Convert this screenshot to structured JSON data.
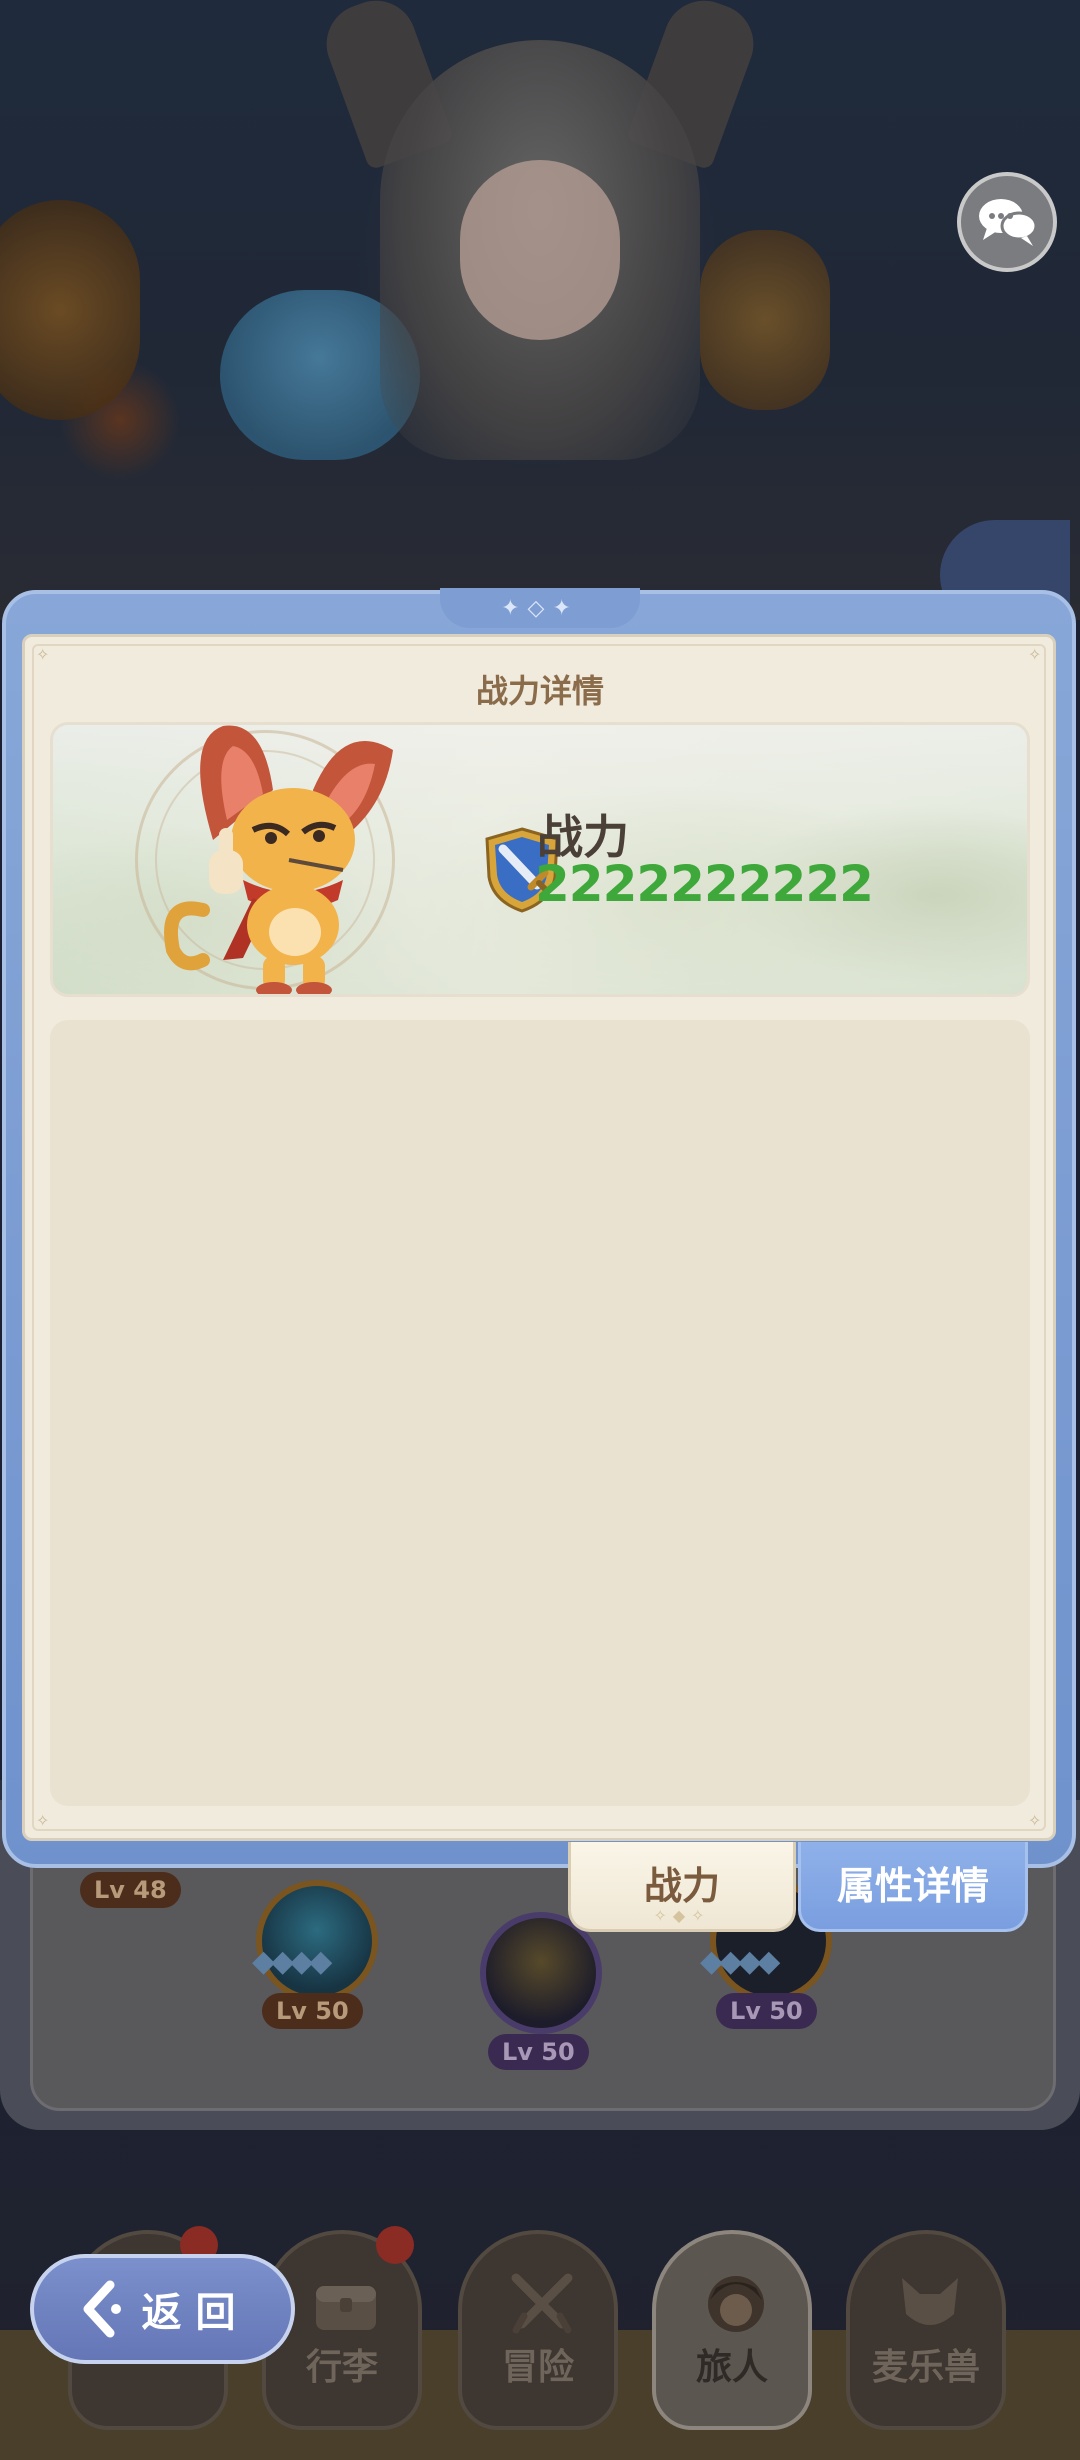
{
  "panel": {
    "title": "战力详情",
    "power_label": "战力",
    "power_value": "2222222222"
  },
  "tabs": [
    {
      "label": "战力",
      "active": true
    },
    {
      "label": "属性详情",
      "active": false
    }
  ],
  "background": {
    "skill_levels": [
      "Lv 48",
      "Lv 50",
      "Lv 50",
      "Lv 50"
    ]
  },
  "bottom_nav": {
    "items": [
      {
        "label": "行李"
      },
      {
        "label": "冒险"
      },
      {
        "label": "旅人"
      },
      {
        "label": "麦乐兽"
      }
    ],
    "active": "旅人",
    "back_label": "返回"
  },
  "icons": {
    "chat": "chat-bubbles-icon",
    "power": "sword-shield-icon",
    "back": "back-arrow-icon"
  },
  "colors": {
    "panel_frame": "#7d9dd3",
    "power_value": "#3ea83a",
    "active_tab": "#f5efe0",
    "inactive_tab": "#88a9e6"
  }
}
